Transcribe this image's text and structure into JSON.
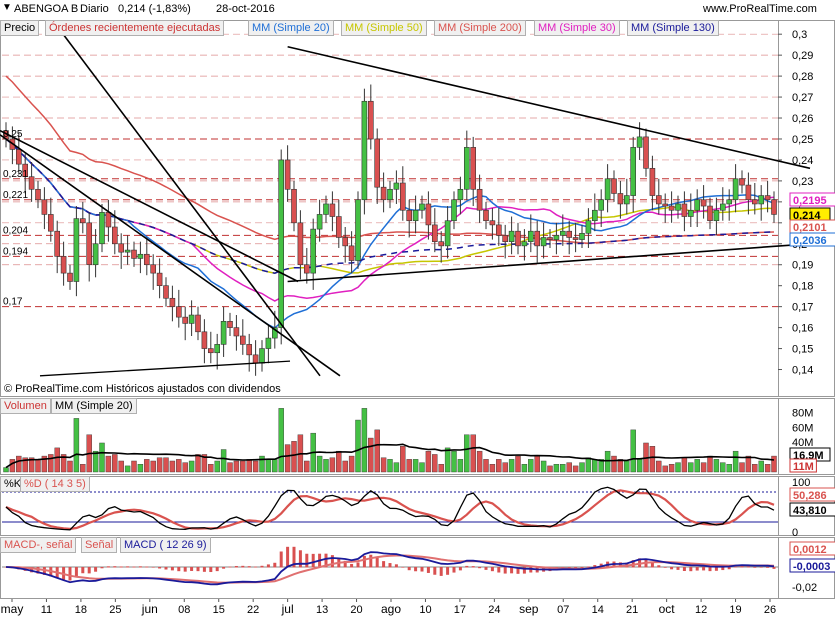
{
  "header": {
    "icon": "dropdown-arrow-icon",
    "instrument": "ABENGOA B",
    "period": "Diario",
    "last": "0,214 (-1,83%)",
    "date": "28-oct-2016",
    "site": "www.ProRealTime.com"
  },
  "price_panel": {
    "labels": [
      {
        "text": "Precio",
        "color": "#000000"
      },
      {
        "text": "Órdenes recientemente ejecutadas",
        "color": "#cc3333"
      },
      {
        "text": "MM (Simple 20)",
        "color": "#1f6fd6"
      },
      {
        "text": "MM (Simple 50)",
        "color": "#c6c600"
      },
      {
        "text": "MM (Simple 200)",
        "color": "#d9534f"
      },
      {
        "text": "MM (Simple 30)",
        "color": "#e020c0"
      },
      {
        "text": "MM (Simple 130)",
        "color": "#1a1a9a"
      }
    ],
    "copyright": "© ProRealTime.com  Históricos ajustados con dividendos",
    "right_ticks": [
      "0,3",
      "0,29",
      "0,28",
      "0,27",
      "0,26",
      "0,25",
      "0,24",
      "0,23",
      "0,22",
      "0,21",
      "0,2",
      "0,19",
      "0,18",
      "0,17",
      "0,16",
      "0,15",
      "0,14"
    ],
    "left_levels": [
      "0,25",
      "0,231",
      "0,221",
      "0,204",
      "0,194",
      "0,17"
    ],
    "badges": [
      {
        "text": "0,2195",
        "color": "#e020c0"
      },
      {
        "text": "0,214",
        "color": "#000000",
        "fill": "#ffee00"
      },
      {
        "text": "0,2101",
        "color": "#d9534f"
      },
      {
        "text": "0,2036",
        "color": "#1f6fd6"
      }
    ]
  },
  "volume_panel": {
    "labels": [
      {
        "text": "Volumen",
        "color": "#cc3333"
      },
      {
        "text": "MM (Simple 20)",
        "color": "#000000"
      }
    ],
    "right_ticks": [
      "80M",
      "60M",
      "40M",
      "20M"
    ],
    "badges": [
      {
        "text": "16,9M",
        "color": "#000000"
      },
      {
        "text": "11M",
        "color": "#cc3333"
      }
    ]
  },
  "stoch_panel": {
    "labels": [
      {
        "text": "%K",
        "color": "#000000"
      },
      {
        "text": "%D ( 14 3 5)",
        "color": "#d9534f"
      }
    ],
    "right_ticks": [
      "100",
      "50",
      "0"
    ],
    "badges": [
      {
        "text": "50,286",
        "color": "#d9534f"
      },
      {
        "text": "43,810",
        "color": "#000000"
      }
    ]
  },
  "macd_panel": {
    "labels": [
      {
        "text": "MACD-, señal",
        "color": "#d9534f"
      },
      {
        "text": "Señal",
        "color": "#d9534f"
      },
      {
        "text": "MACD ( 12 26 9)",
        "color": "#1a1a9a"
      }
    ],
    "right_ticks": [
      "0,02",
      "0",
      "-0,02"
    ],
    "badges": [
      {
        "text": "0,0012",
        "color": "#d9534f"
      },
      {
        "text": "-0,0003",
        "color": "#1a1a9a"
      }
    ]
  },
  "x_axis": [
    "may",
    "11",
    "18",
    "25",
    "jun",
    "08",
    "15",
    "22",
    "jul",
    "13",
    "20",
    "ago",
    "10",
    "17",
    "24",
    "sep",
    "07",
    "14",
    "21",
    "oct",
    "12",
    "19",
    "26"
  ],
  "chart_data": [
    {
      "type": "candlestick",
      "title": "ABENGOA B Diario",
      "ylim": [
        0.135,
        0.302
      ],
      "ylabel": "Precio",
      "x": [
        "may",
        "11",
        "18",
        "25",
        "jun",
        "08",
        "15",
        "22",
        "jul",
        "13",
        "20",
        "ago",
        "10",
        "17",
        "24",
        "sep",
        "07",
        "14",
        "21",
        "oct",
        "12",
        "19",
        "26"
      ],
      "close_series": [
        0.25,
        0.245,
        0.238,
        0.232,
        0.226,
        0.221,
        0.214,
        0.206,
        0.194,
        0.186,
        0.182,
        0.212,
        0.21,
        0.19,
        0.2,
        0.215,
        0.208,
        0.2,
        0.196,
        0.197,
        0.193,
        0.195,
        0.19,
        0.186,
        0.18,
        0.174,
        0.17,
        0.165,
        0.162,
        0.166,
        0.158,
        0.15,
        0.148,
        0.152,
        0.163,
        0.16,
        0.156,
        0.152,
        0.147,
        0.143,
        0.15,
        0.155,
        0.16,
        0.24,
        0.226,
        0.21,
        0.19,
        0.186,
        0.207,
        0.214,
        0.219,
        0.213,
        0.203,
        0.199,
        0.192,
        0.221,
        0.268,
        0.25,
        0.227,
        0.221,
        0.226,
        0.229,
        0.216,
        0.211,
        0.216,
        0.219,
        0.209,
        0.201,
        0.199,
        0.211,
        0.221,
        0.226,
        0.246,
        0.226,
        0.216,
        0.211,
        0.209,
        0.204,
        0.201,
        0.206,
        0.199,
        0.201,
        0.206,
        0.199,
        0.203,
        0.202,
        0.204,
        0.206,
        0.203,
        0.202,
        0.205,
        0.211,
        0.216,
        0.221,
        0.231,
        0.224,
        0.219,
        0.223,
        0.246,
        0.251,
        0.236,
        0.223,
        0.219,
        0.218,
        0.216,
        0.219,
        0.213,
        0.216,
        0.221,
        0.218,
        0.211,
        0.216,
        0.219,
        0.221,
        0.231,
        0.228,
        0.221,
        0.219,
        0.223,
        0.221,
        0.214
      ],
      "series": [
        {
          "name": "MM (Simple 20)",
          "color": "#1f6fd6"
        },
        {
          "name": "MM (Simple 50)",
          "color": "#c6c600"
        },
        {
          "name": "MM (Simple 200)",
          "color": "#d9534f"
        },
        {
          "name": "MM (Simple 30)",
          "color": "#e020c0"
        },
        {
          "name": "MM (Simple 130)",
          "color": "#1a1a9a"
        }
      ],
      "last_values": {
        "close": 0.214,
        "mm30": 0.2195,
        "mm200": 0.2101,
        "mm20": 0.2036
      },
      "trendlines": [
        {
          "from": [
            "jul",
            0.294
          ],
          "to": [
            "26",
            0.236
          ]
        },
        {
          "from": [
            "jul",
            0.182
          ],
          "to": [
            "26",
            0.2
          ]
        }
      ],
      "grid": true
    },
    {
      "type": "bar",
      "title": "Volumen",
      "ylim": [
        0,
        90000000
      ],
      "last_values": {
        "volume_ma20": 16900000,
        "volume": 11000000
      }
    },
    {
      "type": "line",
      "title": "%K %D (14 3 5)",
      "ylim": [
        0,
        100
      ],
      "last_values": {
        "d": 50.286,
        "k": 43.81
      }
    },
    {
      "type": "line",
      "title": "MACD (12 26 9)",
      "ylim": [
        -0.025,
        0.022
      ],
      "last_values": {
        "signal": 0.0012,
        "macd": -0.0003
      }
    }
  ]
}
